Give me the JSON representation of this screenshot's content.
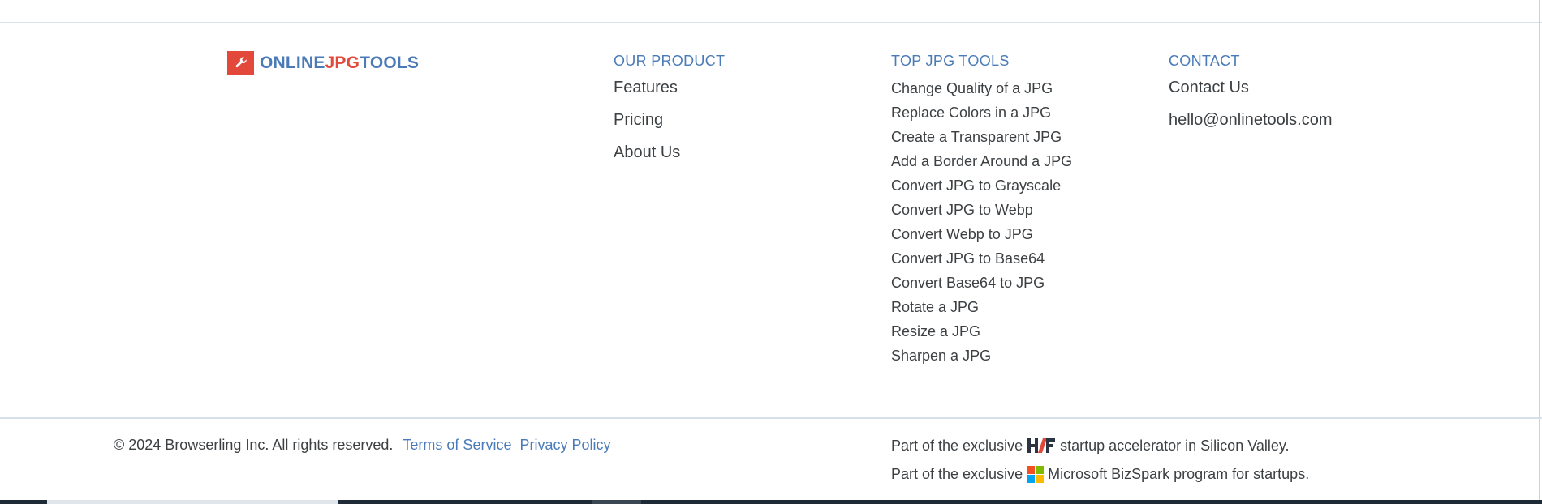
{
  "brand": {
    "logo_part1": "ONLINE",
    "logo_part2": "JPG",
    "logo_part3": "TOOLS",
    "logo_icon": "wrench-icon",
    "colors": {
      "blue": "#4a7bb8",
      "red": "#e2493b"
    }
  },
  "product": {
    "heading": "OUR PRODUCT",
    "links": [
      "Features",
      "Pricing",
      "About Us"
    ]
  },
  "tools": {
    "heading": "TOP JPG TOOLS",
    "links": [
      "Change Quality of a JPG",
      "Replace Colors in a JPG",
      "Create a Transparent JPG",
      "Add a Border Around a JPG",
      "Convert JPG to Grayscale",
      "Convert JPG to Webp",
      "Convert Webp to JPG",
      "Convert JPG to Base64",
      "Convert Base64 to JPG",
      "Rotate a JPG",
      "Resize a JPG",
      "Sharpen a JPG"
    ]
  },
  "contact": {
    "heading": "CONTACT",
    "links": [
      "Contact Us",
      "hello@onlinetools.com"
    ]
  },
  "footer": {
    "copyright": "© 2024 Browserling Inc. All rights reserved.",
    "terms": "Terms of Service",
    "privacy": "Privacy Policy",
    "accelerator_before": "Part of the exclusive",
    "accelerator_after": "startup accelerator in Silicon Valley.",
    "accelerator_icon": "hf-icon",
    "bizspark_before": "Part of the exclusive",
    "bizspark_after": "Microsoft BizSpark program for startups.",
    "bizspark_icon": "microsoft-icon"
  }
}
